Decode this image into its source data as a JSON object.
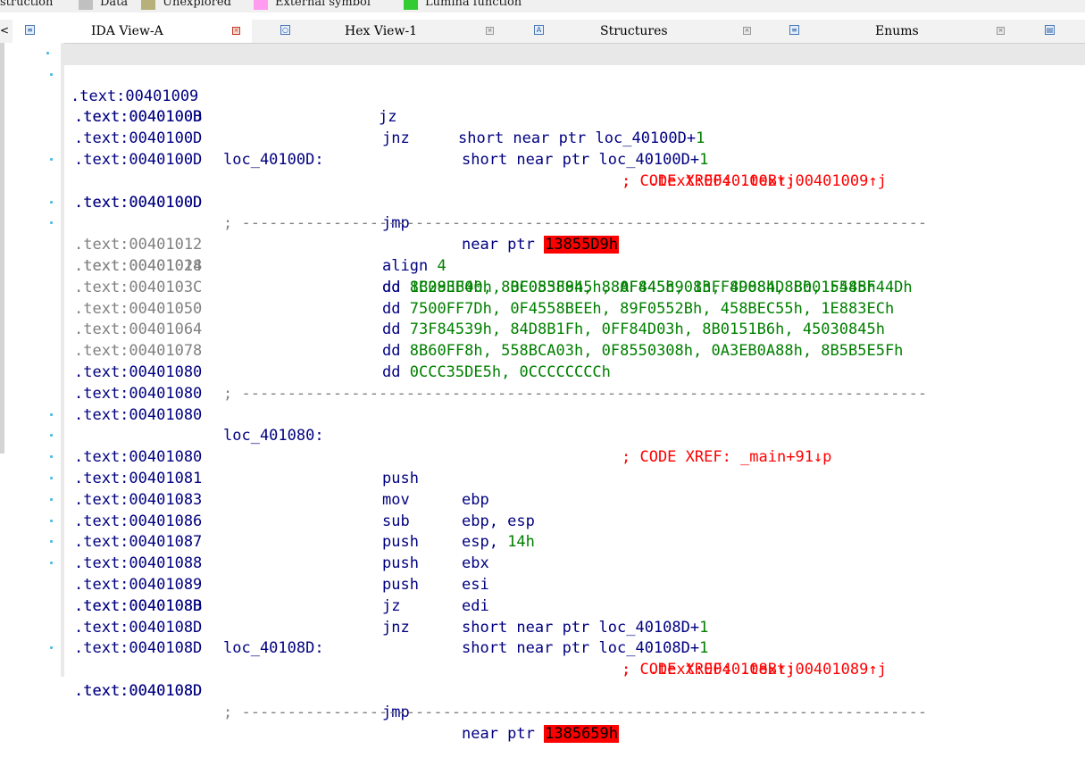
{
  "colors": {
    "address": "#000080",
    "address_undefined": "#808080",
    "number": "#008000",
    "comment": "#ff0000",
    "error_highlight": "#ff0000",
    "legend_data": "#c0c0c0",
    "legend_unexplored": "#b8b07a",
    "legend_external": "#ff9cf0",
    "legend_lumina": "#33cc33"
  },
  "legend": {
    "instruction": "struction",
    "data": "Data",
    "unexplored": "Unexplored",
    "external": "External symbol",
    "lumina": "Lumina function"
  },
  "tabs": [
    {
      "label": "IDA View-A",
      "icon": "ida-view-icon"
    },
    {
      "label": "Hex View-1",
      "icon": "hex-view-icon"
    },
    {
      "label": "Structures",
      "icon": "structures-icon"
    },
    {
      "label": "Enums",
      "icon": "enums-icon"
    }
  ],
  "listing": {
    "r0": {
      "addr": ".text:00401009",
      "mnem": "jz",
      "ops": "short near ptr loc_40100D+",
      "num": "1"
    },
    "r1": {
      "addr": ".text:0040100B",
      "mnem": "jnz",
      "ops": "short near ptr loc_40100D+",
      "num": "1"
    },
    "r2": {
      "addr": ".text:0040100D"
    },
    "r3": {
      "addr": ".text:0040100D",
      "label": "loc_40100D:",
      "comment": "; CODE XREF: .text:00401009↑j"
    },
    "r4": {
      "addr": ".text:0040100D",
      "comment": ";  .text:0040100B↑j"
    },
    "r5": {
      "addr": ".text:0040100D",
      "mnem": "jmp",
      "ops": "near ptr ",
      "bad": "13855D9h"
    },
    "r6": {
      "addr": ".text:0040100D",
      "sep": "; ---------------------------------------------------------------------------"
    },
    "r7": {
      "addr": ".text:00401012",
      "mnem": "align",
      "num": "4"
    },
    "r8": {
      "addr": ".text:00401014",
      "mnem": "dd",
      "num": "8B09EB00h, 0C083F845h, 0F8458901h, 89084D8Bh, 558BF44Dh"
    },
    "r9": {
      "addr": ".text:00401028",
      "mnem": "dd",
      "num": "1C283F4h, 8BF05589h, 88AF445h, 83FF4D88h, 8001F445h"
    },
    "r10": {
      "addr": ".text:0040103C",
      "mnem": "dd",
      "num": "7500FF7Dh, 0F4558BEEh, 89F0552Bh, 458BEC55h, 1E883ECh"
    },
    "r11": {
      "addr": ".text:00401050",
      "mnem": "dd",
      "num": "73F84539h, 84D8B1Fh, 0FF84D03h, 8B0151B6h, 45030845h"
    },
    "r12": {
      "addr": ".text:00401064",
      "mnem": "dd",
      "num": "8B60FF8h, 558BCA03h, 0F8550308h, 0A3EB0A88h, 8B5B5E5Fh"
    },
    "r13": {
      "addr": ".text:00401078",
      "mnem": "dd",
      "num": "0CCC35DE5h, 0CCCCCCCCh"
    },
    "r14": {
      "addr": ".text:00401080",
      "sep": "; ---------------------------------------------------------------------------"
    },
    "r15": {
      "addr": ".text:00401080"
    },
    "r16": {
      "addr": ".text:00401080",
      "label": "loc_401080:",
      "comment": "; CODE XREF: _main+91↓p"
    },
    "r17": {
      "addr": ".text:00401080",
      "mnem": "push",
      "ops": "ebp"
    },
    "r18": {
      "addr": ".text:00401081",
      "mnem": "mov",
      "ops": "ebp, esp"
    },
    "r19": {
      "addr": ".text:00401083",
      "mnem": "sub",
      "ops": "esp, ",
      "num": "14h"
    },
    "r20": {
      "addr": ".text:00401086",
      "mnem": "push",
      "ops": "ebx"
    },
    "r21": {
      "addr": ".text:00401087",
      "mnem": "push",
      "ops": "esi"
    },
    "r22": {
      "addr": ".text:00401088",
      "mnem": "push",
      "ops": "edi"
    },
    "r23": {
      "addr": ".text:00401089",
      "mnem": "jz",
      "ops": "short near ptr loc_40108D+",
      "num": "1"
    },
    "r24": {
      "addr": ".text:0040108B",
      "mnem": "jnz",
      "ops": "short near ptr loc_40108D+",
      "num": "1"
    },
    "r25": {
      "addr": ".text:0040108D"
    },
    "r26": {
      "addr": ".text:0040108D",
      "label": "loc_40108D:",
      "comment": "; CODE XREF: .text:00401089↑j"
    },
    "r27": {
      "addr": ".text:0040108D",
      "comment": ";  .text:0040108B↑j"
    },
    "r28": {
      "addr": ".text:0040108D",
      "mnem": "jmp",
      "ops": "near ptr ",
      "bad": "1385659h"
    },
    "r29": {
      "addr": ".text:0040108D",
      "sep": "; ---------------------------------------------------------------------------"
    }
  }
}
